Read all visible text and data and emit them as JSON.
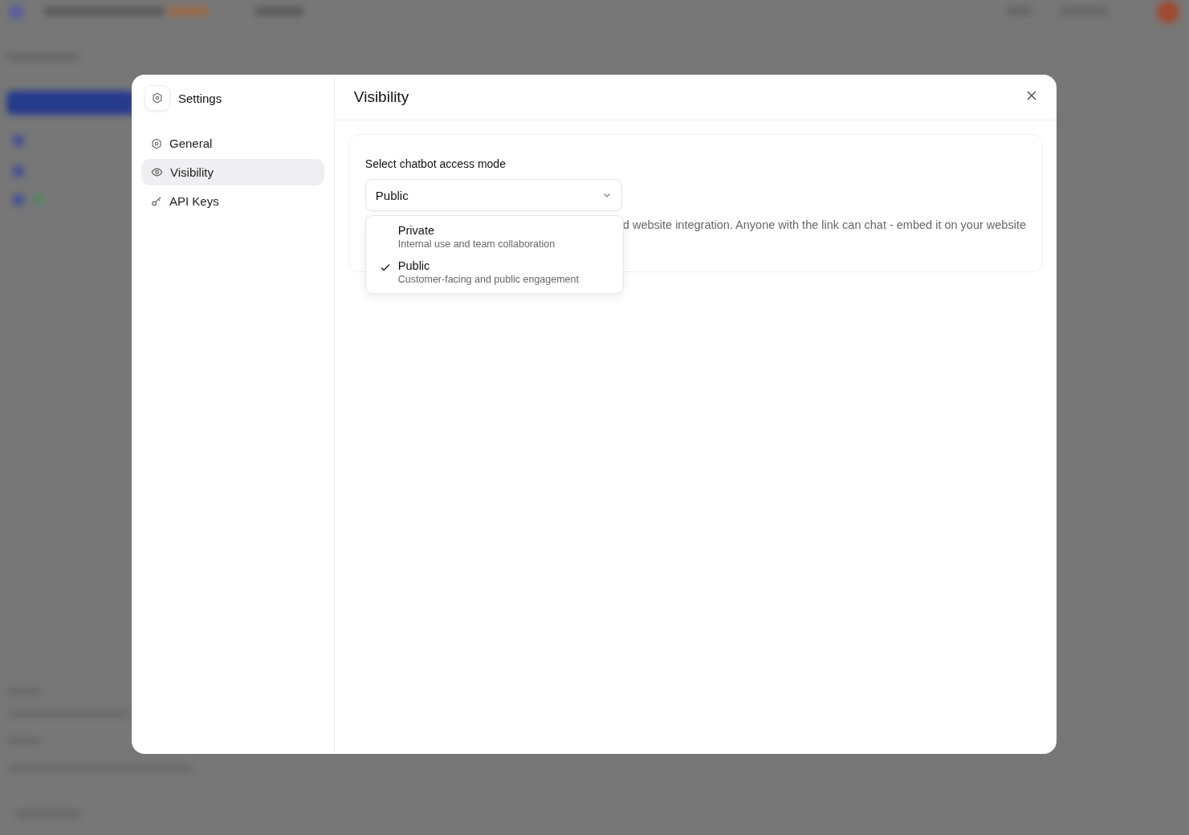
{
  "dialog": {
    "title": "Settings",
    "nav": [
      {
        "label": "General",
        "selected": false
      },
      {
        "label": "Visibility",
        "selected": true
      },
      {
        "label": "API Keys",
        "selected": false
      }
    ]
  },
  "panel": {
    "title": "Visibility",
    "field_label": "Select chatbot access mode",
    "value": "Public",
    "description": "d website integration. Anyone with the link can chat - embed it on your website",
    "options": [
      {
        "label": "Private",
        "hint": "Internal use and team collaboration",
        "selected": false
      },
      {
        "label": "Public",
        "hint": "Customer-facing and public engagement",
        "selected": true
      }
    ]
  }
}
